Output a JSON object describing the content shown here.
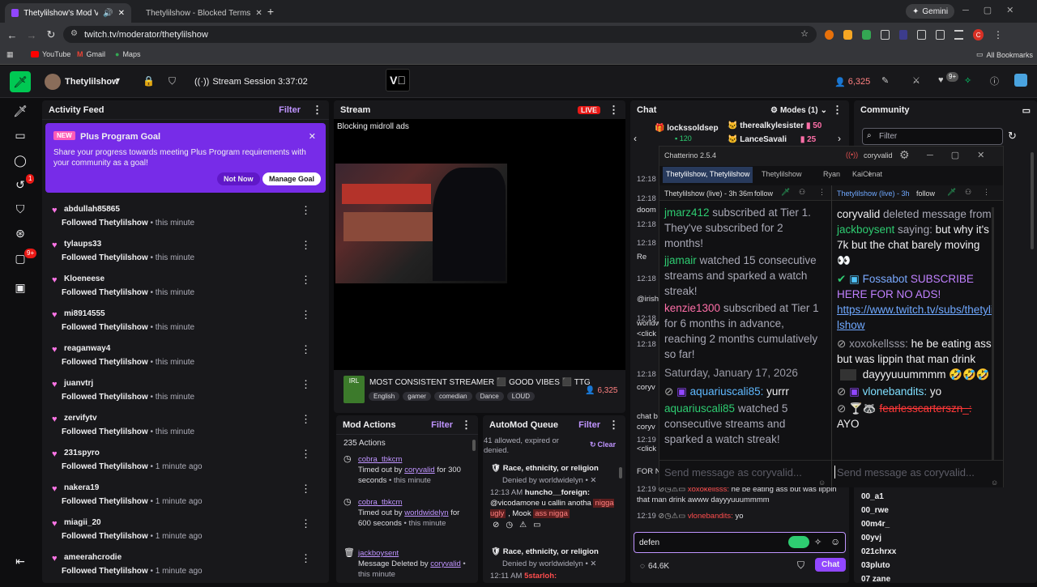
{
  "browser": {
    "tabs": [
      {
        "title": "Thetylilshow's Mod View -"
      },
      {
        "title": "Thetylilshow - Blocked Terms"
      }
    ],
    "url": "twitch.tv/moderator/thetylilshow",
    "profile": "Gemini",
    "bookmarks": [
      "YouTube",
      "Gmail",
      "Maps"
    ],
    "all_bookmarks": "All Bookmarks",
    "avatar_letter": "C"
  },
  "topbar": {
    "channel": "Thetylilshow",
    "session": "Stream Session 3:37:02",
    "viewers": "6,325",
    "notif": "9+"
  },
  "rail": {
    "badge1": "1",
    "badge2": "9+"
  },
  "activity": {
    "title": "Activity Feed",
    "filter": "Filter",
    "promo": {
      "new": "NEW",
      "title": "Plus Program Goal",
      "body": "Share your progress towards meeting Plus Program requirements with your community as a goal!",
      "not_now": "Not Now",
      "manage": "Manage Goal"
    },
    "items": [
      {
        "name": "abdullah85865",
        "action": "Followed",
        "target": "Thetylilshow",
        "time": "• this minute"
      },
      {
        "name": "tylaups33",
        "action": "Followed",
        "target": "Thetylilshow",
        "time": "• this minute"
      },
      {
        "name": "Kloeneese",
        "action": "Followed",
        "target": "Thetylilshow",
        "time": "• this minute"
      },
      {
        "name": "mi8914555",
        "action": "Followed",
        "target": "Thetylilshow",
        "time": "• this minute"
      },
      {
        "name": "reaganway4",
        "action": "Followed",
        "target": "Thetylilshow",
        "time": "• this minute"
      },
      {
        "name": "juanvtrj",
        "action": "Followed",
        "target": "Thetylilshow",
        "time": "• this minute"
      },
      {
        "name": "zervifytv",
        "action": "Followed",
        "target": "Thetylilshow",
        "time": "• this minute"
      },
      {
        "name": "231spyro",
        "action": "Followed",
        "target": "Thetylilshow",
        "time": "• 1 minute ago"
      },
      {
        "name": "nakera19",
        "action": "Followed",
        "target": "Thetylilshow",
        "time": "• 1 minute ago"
      },
      {
        "name": "miagii_20",
        "action": "Followed",
        "target": "Thetylilshow",
        "time": "• 1 minute ago"
      },
      {
        "name": "ameerahcrodie",
        "action": "Followed",
        "target": "Thetylilshow",
        "time": "• 1 minute ago"
      }
    ]
  },
  "stream": {
    "title": "Stream",
    "live": "LIVE",
    "overlay": "Blocking midroll ads",
    "stream_title": "MOST CONSISTENT STREAMER ⬛ GOOD VIBES ⬛ TTG",
    "tags": [
      "English",
      "gamer",
      "comedian",
      "Dance",
      "LOUD"
    ],
    "viewers": "6,325",
    "irl": "IRL"
  },
  "modactions": {
    "title": "Mod Actions",
    "filter": "Filter",
    "count": "235 Actions",
    "items": [
      {
        "user": "cobra_tbkcm",
        "text": "Timed out by",
        "mod": "coryvalid",
        "text2": "for 300 seconds",
        "time": "• this minute"
      },
      {
        "user": "cobra_tbkcm",
        "text": "Timed out by",
        "mod": "worldwidelyn",
        "text2": "for 600 seconds",
        "time": "• this minute"
      },
      {
        "user": "jackboysent",
        "text": "Message Deleted by",
        "mod": "coryvalid",
        "text2": "",
        "time": "• this minute"
      }
    ]
  },
  "automod": {
    "title": "AutoMod Queue",
    "filter": "Filter",
    "info": "41 allowed, expired or denied.",
    "clear": "Clear",
    "items": [
      {
        "category": "Race, ethnicity, or religion",
        "status": "Denied by worldwidelyn •",
        "time": "12:13 AM",
        "user": "huncho__foreign:",
        "msg1": "@vicodamone u callin anotha",
        "flag1": "nigga ugly",
        "msg2": ", Mook",
        "flag2": "ass nigga"
      },
      {
        "category": "Race, ethnicity, or religion",
        "status": "Denied by worldwidelyn •",
        "time": "12:11 AM",
        "user": "5starloh:"
      }
    ]
  },
  "chat": {
    "title": "Chat",
    "modes": "Modes (1)",
    "gifters": [
      {
        "name": "lockssoldsep",
        "count": "120"
      },
      {
        "name": "therealkylesister",
        "count": "50"
      },
      {
        "name": "LanceSavali",
        "count": "25"
      }
    ],
    "bg_times": [
      "12:18",
      "12:18",
      "12:18",
      "12:18",
      "12:18",
      "12:18",
      "12:18",
      "12:18",
      "12:19"
    ],
    "bg_snips": [
      "doom",
      "Re",
      "@irish",
      "worldw",
      "<click",
      "coryv",
      "chat b",
      "coryv",
      "<click",
      "FOR N"
    ],
    "bottom1": {
      "time": "12:19",
      "user": "xoxokellsss:",
      "msg": "he be eating ass but was lippin that man drink awww dayyyuuummmm"
    },
    "bottom2": {
      "time": "12:19",
      "user": "vlonebandits:",
      "msg": "yo"
    },
    "input": "defen",
    "viewers": "64.6K",
    "chat_btn": "Chat"
  },
  "community": {
    "title": "Community",
    "filter_placeholder": "Filter",
    "users": [
      "00_a1",
      "00_rwe",
      "00m4r_",
      "00yvj",
      "021chrxx",
      "03pluto",
      "07 zane"
    ]
  },
  "chatterino": {
    "title": "Chatterino 2.5.4",
    "account": "coryvalid",
    "tabs": [
      "Thetylilshow, Thetylilshow",
      "Thetylilshow",
      "Ryan",
      "KaiCenat"
    ],
    "left_header": {
      "title": "Thetylilshow (live) - 3h 36m",
      "follow": "follow"
    },
    "right_header": {
      "title": "Thetylilshow (live) - 3h",
      "follow": "follow"
    },
    "left": [
      {
        "user": "jmarz412",
        "text": " subscribed at Tier 1. They've subscribed for 2 months!"
      },
      {
        "user": "jjamair",
        "text": " watched 15 consecutive streams and sparked a watch streak!"
      },
      {
        "user": "kenzie1300",
        "text": " subscribed at Tier 1 for 6 months in advance, reaching 2 months cumulatively so far!"
      },
      {
        "date": "Saturday, January 17, 2026"
      },
      {
        "user": "aquariuscali85:",
        "text": " yurrr"
      },
      {
        "user": "aquariuscali85",
        "text": " watched 5 consecutive streams and sparked a watch streak!"
      }
    ],
    "right": {
      "del_user": "coryvalid",
      "del_text": " deleted message from ",
      "del_target": "jackboysent",
      "del_saying": " saying: ",
      "del_msg": "but why it's 7k but the chat barely moving 👀",
      "bot": "Fossabot",
      "bot_msg": " SUBSCRIBE HERE FOR NO ADS!",
      "link": "https://www.twitch.tv/subs/thetylilshow",
      "u1": "xoxokellsss:",
      "m1": " he be eating ass but was lippin that man drink",
      "m1b": " dayyyuuummmm 🤣🤣🤣",
      "u2": "vlonebandits:",
      "m2": " yo",
      "u3": "fearlesscarterszn_:",
      "m3": "AYO"
    },
    "input_placeholder": "Send message as coryvalid..."
  }
}
